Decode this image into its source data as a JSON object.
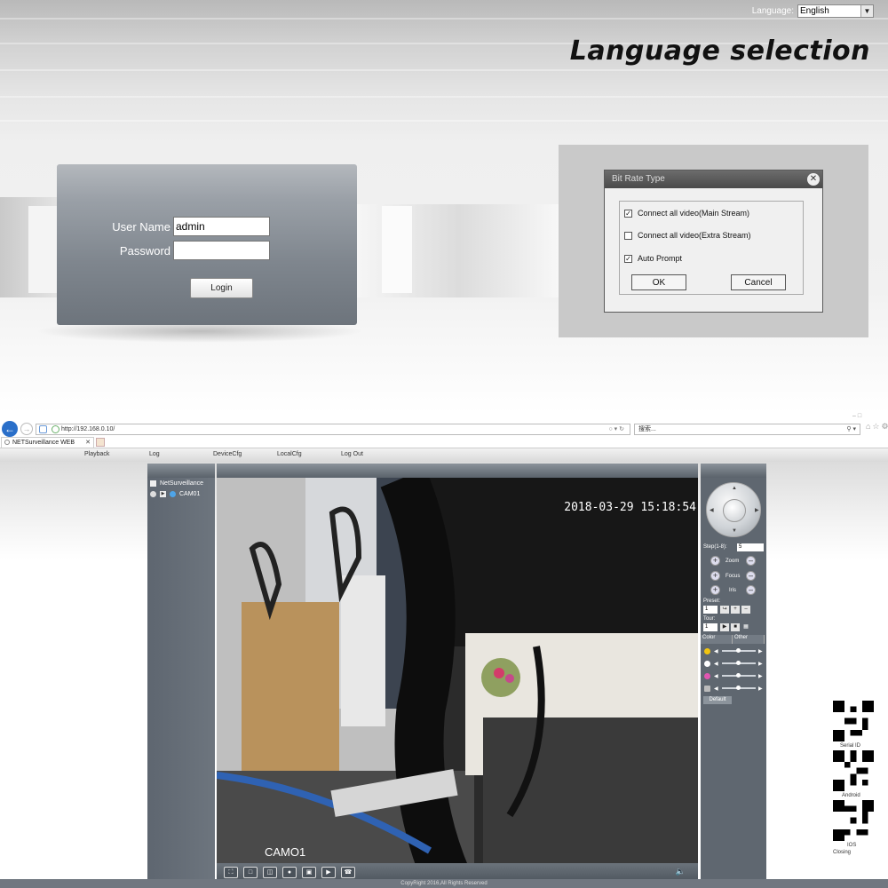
{
  "header": {
    "language_label": "Language:",
    "language_value": "English",
    "heading": "Language selection"
  },
  "login": {
    "username_label": "User Name",
    "username_value": "admin",
    "password_label": "Password",
    "password_value": "",
    "login_button": "Login"
  },
  "dialog": {
    "title": "Bit Rate Type",
    "options": [
      {
        "label": "Connect all video(Main Stream)",
        "checked": true
      },
      {
        "label": "Connect all video(Extra Stream)",
        "checked": false
      },
      {
        "label": "Auto Prompt",
        "checked": true
      }
    ],
    "ok_button": "OK",
    "cancel_button": "Cancel"
  },
  "browser": {
    "url": "http://192.168.0.10/",
    "search_placeholder": "搜索...",
    "tab_title": "NETSurveillance WEB",
    "menu": [
      "Playback",
      "Log",
      "DeviceCfg",
      "LocalCfg",
      "Log Out"
    ]
  },
  "app": {
    "tree_root": "NetSurveillance",
    "camera": "CAM01",
    "timestamp": "2018-03-29  15:18:54",
    "channel_label": "CAMO1",
    "step_label": "Step(1-8):",
    "step_value": "5",
    "zoom_label": "Zoom",
    "focus_label": "Focus",
    "iris_label": "Iris",
    "preset_label": "Preset:",
    "preset_value": "1",
    "tour_label": "Tour:",
    "tour_value": "1",
    "color_tab": "Color",
    "other_tab": "Other",
    "default_button": "Default",
    "footer": "CopyRight 2016,All Rights Reserved"
  },
  "qr": {
    "labels": [
      "Serial ID",
      "Android",
      "IOS",
      "Closing"
    ]
  },
  "colors": {
    "panel_gray": "#6d747c",
    "dialog_bg": "#c9c9c9",
    "browser_blue": "#2a6fc9"
  }
}
